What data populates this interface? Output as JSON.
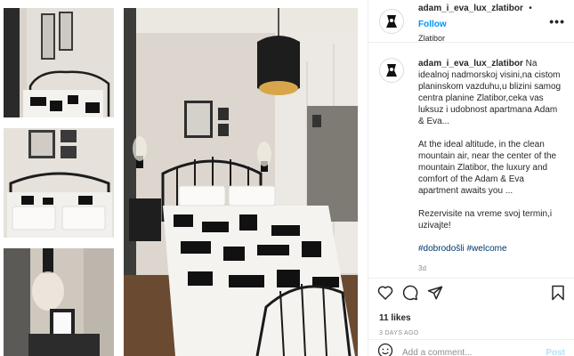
{
  "post": {
    "username": "adam_i_eva_lux_zlatibor",
    "follow_label": "Follow",
    "dot": "•",
    "location": "Zlatibor",
    "more_label": "•••"
  },
  "caption": {
    "username": "adam_i_eva_lux_zlatibor",
    "text_sr": "Na idealnoj nadmorskoj visini,na cistom planinskom vazduhu,u blizini samog centra planine Zlatibor,ceka vas luksuz i udobnost apartmana Adam & Eva...",
    "text_en": "At the ideal altitude, in the clean mountain air, near the center of the mountain Zlatibor, the luxury and comfort of the Adam & Eva apartment awaits you ...",
    "text_cta": "Rezervisite na vreme svoj termin,i uzivajte!",
    "hashtag1": "#dobrodošli",
    "hashtag2": "#welcome",
    "age": "3d"
  },
  "engagement": {
    "likes": "11 likes",
    "posted": "3 DAYS AGO"
  },
  "comment": {
    "placeholder": "Add a comment...",
    "post_label": "Post"
  },
  "icons": {
    "like": "heart-icon",
    "comment": "comment-icon",
    "share": "share-icon",
    "save": "bookmark-icon",
    "emoji": "emoji-icon"
  },
  "colors": {
    "follow": "#0095f6",
    "hashtag": "#00376b",
    "muted": "#8e8e8e",
    "post_disabled": "#b2dffc"
  }
}
